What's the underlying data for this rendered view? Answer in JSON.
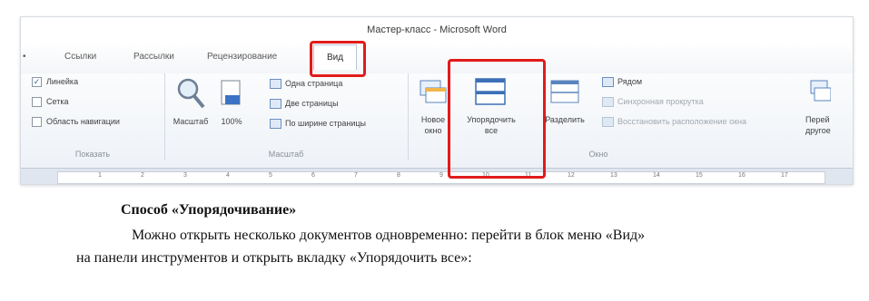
{
  "window": {
    "title": "Мастер-класс - Microsoft Word"
  },
  "tabs": [
    {
      "label": "Ссылки"
    },
    {
      "label": "Рассылки"
    },
    {
      "label": "Рецензирование"
    },
    {
      "label": "Вид"
    }
  ],
  "ribbon": {
    "show_group": {
      "label": "Показать",
      "items": [
        {
          "label": "Линейка",
          "checked": true
        },
        {
          "label": "Сетка",
          "checked": false
        },
        {
          "label": "Область навигации",
          "checked": false
        }
      ]
    },
    "zoom_group": {
      "label": "Масштаб",
      "zoom_button": "Масштаб",
      "percent_button": "100%",
      "one_page": "Одна страница",
      "two_pages": "Две страницы",
      "page_width": "По ширине страницы"
    },
    "window_group": {
      "label": "Окно",
      "new_window": [
        "Новое",
        "окно"
      ],
      "arrange_all": [
        "Упорядочить",
        "все"
      ],
      "split": "Разделить",
      "side_by_side": "Рядом",
      "sync_scroll": "Синхронная прокрутка",
      "reset_position": "Восстановить расположение окна",
      "switch_windows": [
        "Перей",
        "другое"
      ]
    }
  },
  "ruler": {
    "numbers": [
      "1",
      "2",
      "3",
      "4",
      "5",
      "6",
      "7",
      "8",
      "9",
      "10",
      "11",
      "12",
      "13",
      "14",
      "15",
      "16",
      "17"
    ]
  },
  "document": {
    "heading": "Способ «Упорядочивание»",
    "line1": "Можно открыть несколько документов одновременно: перейти в блок меню «Вид»",
    "line2": "на панели инструментов и открыть вкладку «Упорядочить все»:"
  },
  "colors": {
    "highlight": "#e11b1b",
    "accent": "#3465a4"
  }
}
